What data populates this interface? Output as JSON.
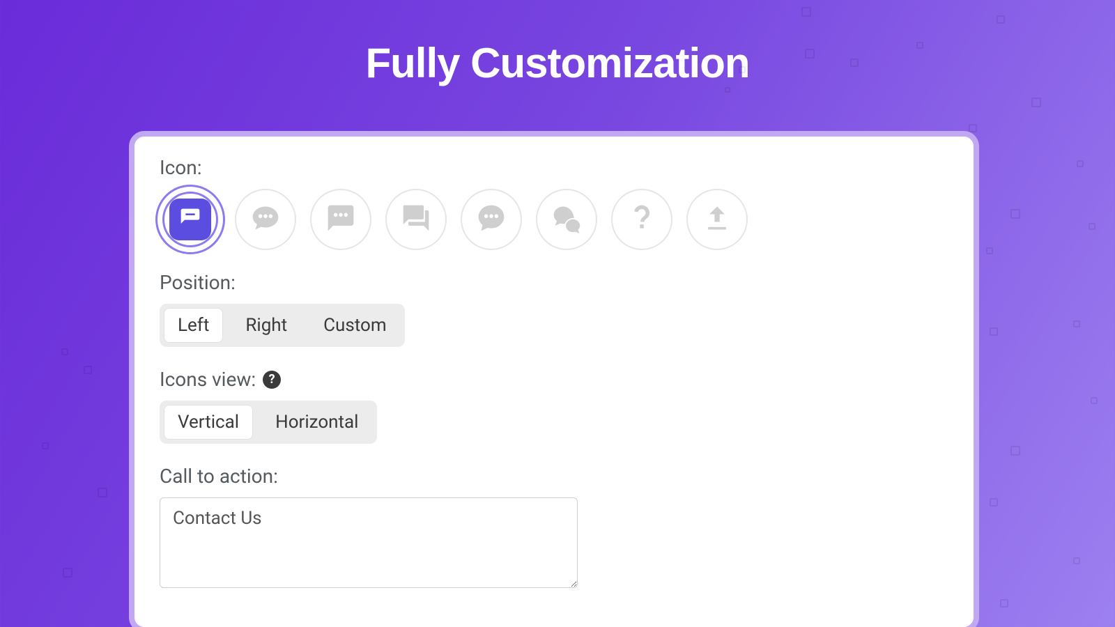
{
  "page": {
    "title": "Fully Customization"
  },
  "form": {
    "icon_label": "Icon:",
    "icons": [
      {
        "name": "chat-bubble-lines-icon",
        "selected": true
      },
      {
        "name": "chat-bubble-dots-outline-icon",
        "selected": false
      },
      {
        "name": "chat-bubble-dots-solid-icon",
        "selected": false
      },
      {
        "name": "chat-bubbles-stack-icon",
        "selected": false
      },
      {
        "name": "chat-round-dots-icon",
        "selected": false
      },
      {
        "name": "chat-pair-icon",
        "selected": false
      },
      {
        "name": "question-mark-icon",
        "selected": false
      },
      {
        "name": "upload-icon",
        "selected": false
      }
    ],
    "position_label": "Position:",
    "position_options": [
      "Left",
      "Right",
      "Custom"
    ],
    "position_selected": "Left",
    "icons_view_label": "Icons view:",
    "icons_view_options": [
      "Vertical",
      "Horizontal"
    ],
    "icons_view_selected": "Vertical",
    "cta_label": "Call to action:",
    "cta_value": "Contact Us"
  }
}
